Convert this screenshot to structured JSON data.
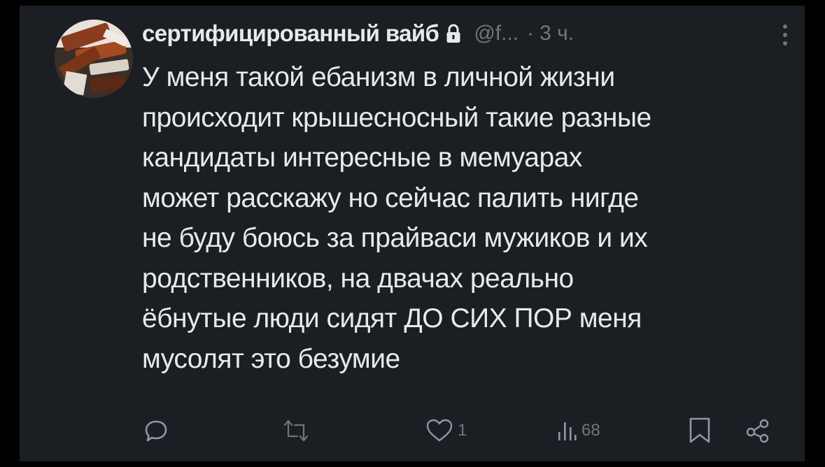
{
  "post": {
    "author_name": "сертифицированный вайб",
    "handle": "@f...",
    "separator": "·",
    "time": "3 ч.",
    "text": "У меня такой ебанизм в личной жизни\nпроисходит крышесносный такие разные\nкандидаты интересные в мемуарах\nможет расскажу но сейчас палить нигде\nне буду боюсь за прайваси мужиков и их\nродственников, на двачах реально\nёбнутые люди сидят ДО СИХ ПОР меня\nмусолят это безумие"
  },
  "actions": {
    "reply_count": "",
    "repost_count": "",
    "like_count": "1",
    "views_count": "68"
  },
  "icons": {
    "avatar": "avatar-photo",
    "lock": "lock-icon",
    "more": "more-vertical-icon",
    "reply": "reply-icon",
    "repost": "repost-icon",
    "like": "heart-icon",
    "views": "views-icon",
    "bookmark": "bookmark-icon",
    "share": "share-icon"
  },
  "colors": {
    "background": "#000000",
    "card": "#1b1e23",
    "text_primary": "#e7e9ea",
    "text_secondary": "#71767b"
  }
}
